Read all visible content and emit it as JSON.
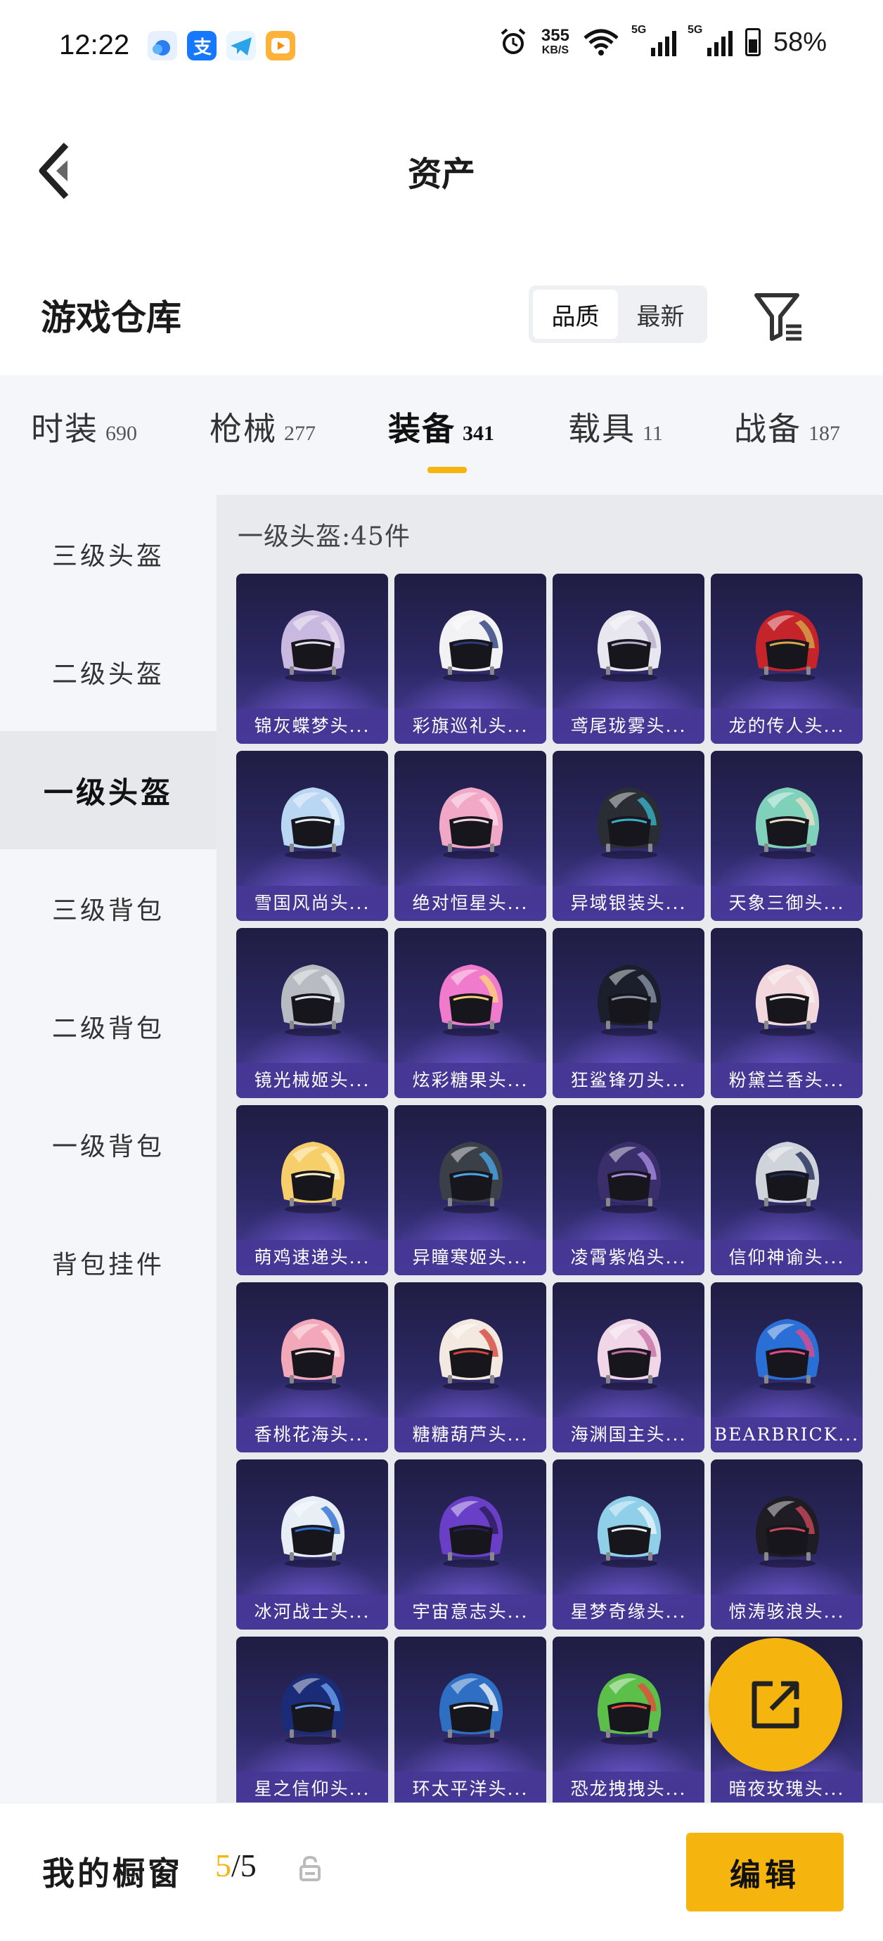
{
  "status_bar": {
    "time": "12:22",
    "speed_value": "355",
    "speed_unit": "KB/S",
    "network": "5G",
    "battery": "58%"
  },
  "header": {
    "title": "资产"
  },
  "warehouse": {
    "title": "游戏仓库",
    "sort_options": [
      "品质",
      "最新"
    ],
    "active_sort": "品质"
  },
  "categories": [
    {
      "name": "时装",
      "count": "690"
    },
    {
      "name": "枪械",
      "count": "277"
    },
    {
      "name": "装备",
      "count": "341",
      "active": true
    },
    {
      "name": "载具",
      "count": "11"
    },
    {
      "name": "战备",
      "count": "187"
    }
  ],
  "sidebar": {
    "items": [
      "三级头盔",
      "二级头盔",
      "一级头盔",
      "三级背包",
      "二级背包",
      "一级背包",
      "背包挂件"
    ],
    "active": "一级头盔"
  },
  "content": {
    "header": "一级头盔:45件",
    "items": [
      {
        "name": "锦灰蝶梦头...",
        "color": "#c9b8e0",
        "accent": "#e8dff0"
      },
      {
        "name": "彩旗巡礼头...",
        "color": "#f2f2f5",
        "accent": "#2a3c7a"
      },
      {
        "name": "鸢尾珑雾头...",
        "color": "#e8e6ee",
        "accent": "#b8b0cc"
      },
      {
        "name": "龙的传人头...",
        "color": "#c4242a",
        "accent": "#d6a84a"
      },
      {
        "name": "雪国风尚头...",
        "color": "#b9d6f2",
        "accent": "#e9f1fb"
      },
      {
        "name": "绝对恒星头...",
        "color": "#f1a8c6",
        "accent": "#ffd6e6"
      },
      {
        "name": "异域银装头...",
        "color": "#2a2d34",
        "accent": "#3ab0c8"
      },
      {
        "name": "天象三御头...",
        "color": "#7fd1b9",
        "accent": "#e8e0c8"
      },
      {
        "name": "镜光械姬头...",
        "color": "#b8bcc2",
        "accent": "#e8ecf0"
      },
      {
        "name": "炫彩糖果头...",
        "color": "#f07acb",
        "accent": "#ffd27a"
      },
      {
        "name": "狂鲨锋刃头...",
        "color": "#1b1f2b",
        "accent": "#8a93a8"
      },
      {
        "name": "粉黛兰香头...",
        "color": "#f2d8dc",
        "accent": "#f5eef0"
      },
      {
        "name": "萌鸡速递头...",
        "color": "#f6cf6a",
        "accent": "#fff2c8"
      },
      {
        "name": "异瞳寒姬头...",
        "color": "#3b3f48",
        "accent": "#4aa8e8"
      },
      {
        "name": "凌霄紫焰头...",
        "color": "#3a2f6a",
        "accent": "#a98be0"
      },
      {
        "name": "信仰神谕头...",
        "color": "#cfd3da",
        "accent": "#1f2c56"
      },
      {
        "name": "香桃花海头...",
        "color": "#f2a8b8",
        "accent": "#ffe0e6"
      },
      {
        "name": "糖糖葫芦头...",
        "color": "#f4e9e0",
        "accent": "#d6453c"
      },
      {
        "name": "海渊国主头...",
        "color": "#f0d6e6",
        "accent": "#c86fa8"
      },
      {
        "name": "BEARBRICK...",
        "color": "#2a6fd6",
        "accent": "#e24a8a"
      },
      {
        "name": "冰河战士头...",
        "color": "#e8eef6",
        "accent": "#2f6fd0"
      },
      {
        "name": "宇宙意志头...",
        "color": "#6a3fc8",
        "accent": "#2a1c58"
      },
      {
        "name": "星梦奇缘头...",
        "color": "#8fd0e8",
        "accent": "#e8f4fb"
      },
      {
        "name": "惊涛骇浪头...",
        "color": "#1f1c24",
        "accent": "#c84a5a"
      },
      {
        "name": "星之信仰头...",
        "color": "#1a2c78",
        "accent": "#6aa0f0"
      },
      {
        "name": "环太平洋头...",
        "color": "#2e6fc4",
        "accent": "#f2f4f8"
      },
      {
        "name": "恐龙拽拽头...",
        "color": "#5cbf4a",
        "accent": "#e84a3a"
      },
      {
        "name": "暗夜玫瑰头...",
        "color": "#2a1f38",
        "accent": "#8a3a6a"
      }
    ]
  },
  "bottom_bar": {
    "label": "我的橱窗",
    "current": "5",
    "total": "/5",
    "edit_label": "编辑"
  },
  "colors": {
    "accent": "#f6b40e",
    "card_bg": "#2c2865",
    "card_label_bg": "#463796"
  }
}
